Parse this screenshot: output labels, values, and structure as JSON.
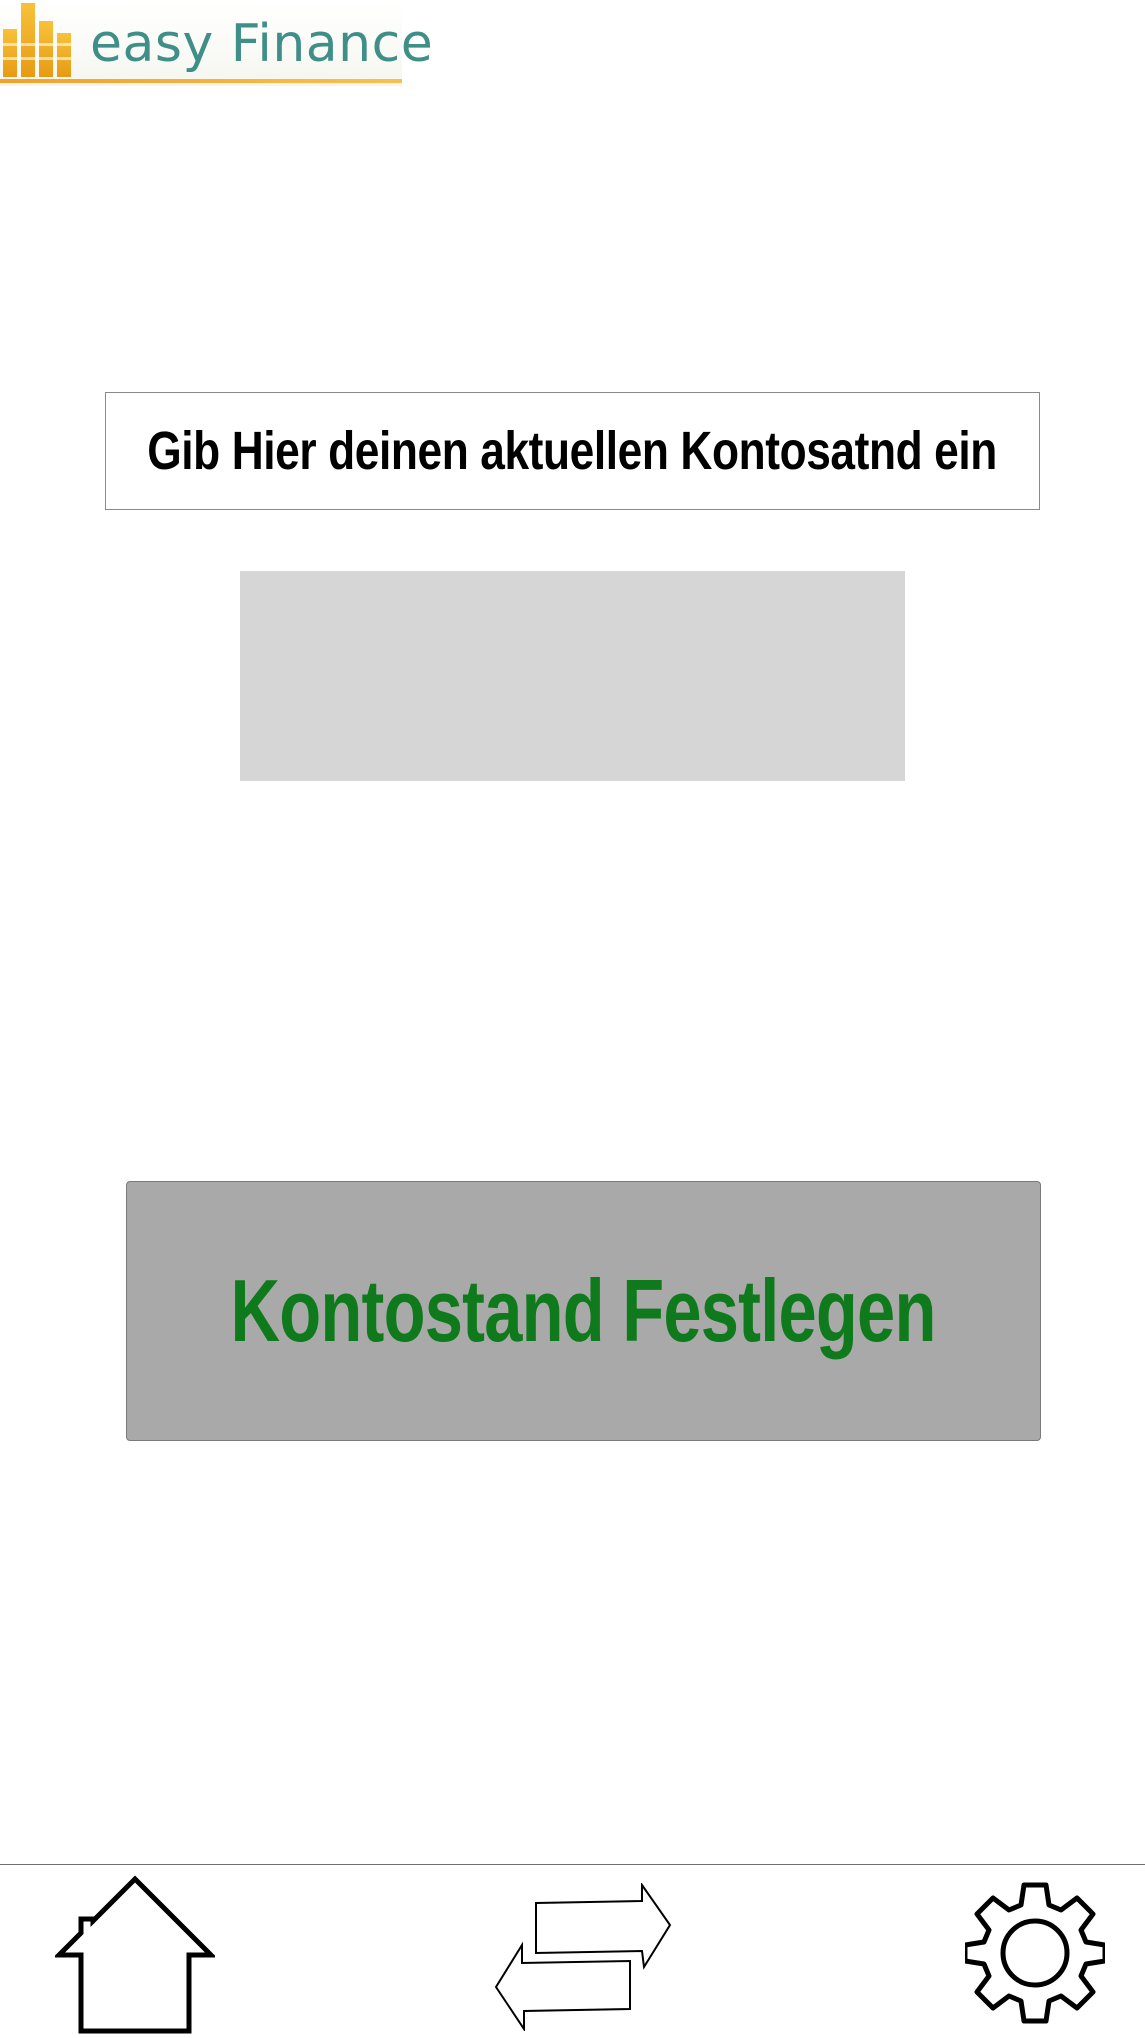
{
  "app": {
    "logo_text": "easy Finance",
    "brand_color": "#3f8f88",
    "accent_color": "#f2a12a"
  },
  "form": {
    "instruction": "Gib Hier deinen aktuellen Kontosatnd ein",
    "input_value": "",
    "input_placeholder": "",
    "submit_label": "Kontostand Festlegen",
    "submit_text_color": "#0f7a1c",
    "submit_bg_color": "#a9a9a9"
  },
  "bottom_nav": {
    "items": [
      {
        "name": "home",
        "icon": "home-icon"
      },
      {
        "name": "transfer",
        "icon": "transfer-arrows-icon"
      },
      {
        "name": "settings",
        "icon": "gear-icon"
      }
    ]
  }
}
